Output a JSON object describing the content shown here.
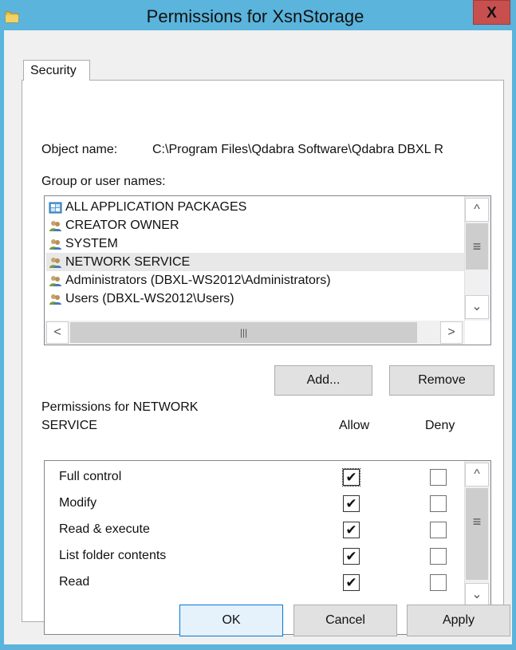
{
  "window": {
    "title": "Permissions for XsnStorage",
    "close_label": "X"
  },
  "tab": {
    "label": "Security"
  },
  "object": {
    "label": "Object name:",
    "value": "C:\\Program Files\\Qdabra Software\\Qdabra DBXL R"
  },
  "groups": {
    "label": "Group or user names:",
    "items": [
      {
        "label": "ALL APPLICATION PACKAGES",
        "icon": "packages-icon",
        "selected": false
      },
      {
        "label": "CREATOR OWNER",
        "icon": "users-icon",
        "selected": false
      },
      {
        "label": "SYSTEM",
        "icon": "users-icon",
        "selected": false
      },
      {
        "label": "NETWORK SERVICE",
        "icon": "users-icon",
        "selected": true
      },
      {
        "label": "Administrators (DBXL-WS2012\\Administrators)",
        "icon": "users-icon",
        "selected": false
      },
      {
        "label": "Users (DBXL-WS2012\\Users)",
        "icon": "users-icon",
        "selected": false
      }
    ]
  },
  "buttons": {
    "add": "Add...",
    "remove": "Remove",
    "ok": "OK",
    "cancel": "Cancel",
    "apply": "Apply"
  },
  "permissions": {
    "label_line1": "Permissions for NETWORK",
    "label_line2": "SERVICE",
    "allow_header": "Allow",
    "deny_header": "Deny",
    "rows": [
      {
        "name": "Full control",
        "allow": true,
        "deny": false
      },
      {
        "name": "Modify",
        "allow": true,
        "deny": false
      },
      {
        "name": "Read & execute",
        "allow": true,
        "deny": false
      },
      {
        "name": "List folder contents",
        "allow": true,
        "deny": false
      },
      {
        "name": "Read",
        "allow": true,
        "deny": false
      }
    ]
  },
  "glyphs": {
    "up": "^",
    "down": "⌄",
    "left": "<",
    "right": ">",
    "grip_v": "≡",
    "grip_h": "|||",
    "check": "✔"
  },
  "colors": {
    "titlebar": "#5ab4dc",
    "close": "#c7504f",
    "selection": "#e8e8e8"
  }
}
